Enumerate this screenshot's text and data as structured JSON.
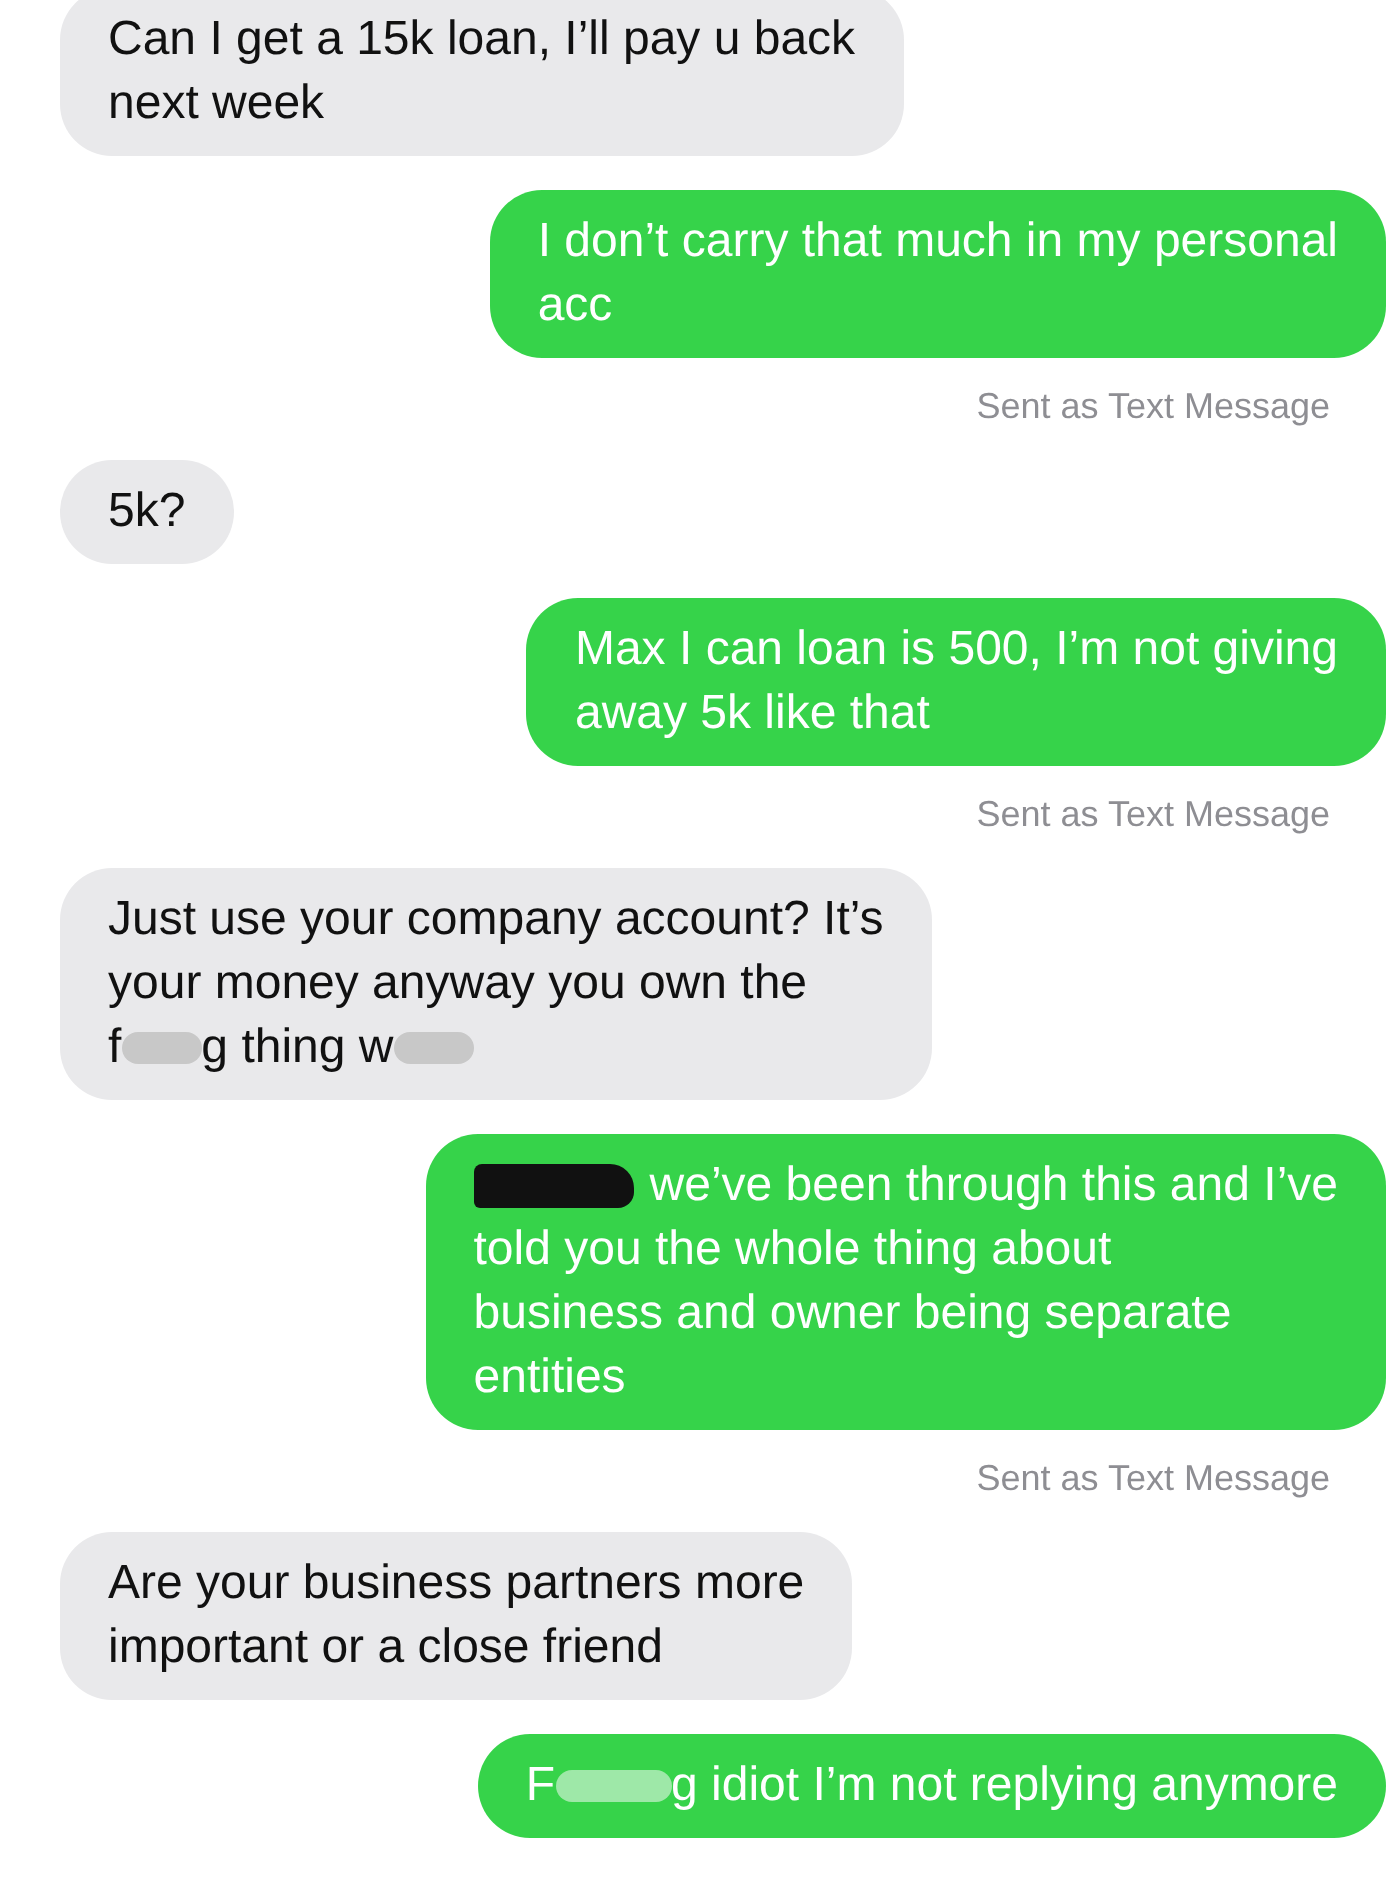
{
  "messages": [
    {
      "kind": "received",
      "lines": [
        [
          {
            "kind": "text",
            "text": "Can I get a 15k loan, I’ll pay u back"
          }
        ],
        [
          {
            "kind": "text",
            "text": "next week"
          }
        ]
      ]
    },
    {
      "kind": "sent",
      "lines": [
        [
          {
            "kind": "text",
            "text": "I don’t carry that much in my personal"
          }
        ],
        [
          {
            "kind": "text",
            "text": "acc"
          }
        ]
      ],
      "status": "Sent as Text Message"
    },
    {
      "kind": "received",
      "lines": [
        [
          {
            "kind": "text",
            "text": "5k?"
          }
        ]
      ]
    },
    {
      "kind": "sent",
      "lines": [
        [
          {
            "kind": "text",
            "text": "Max I can loan is 500, I’m not giving"
          }
        ],
        [
          {
            "kind": "text",
            "text": "away 5k like that"
          }
        ]
      ],
      "status": "Sent as Text Message"
    },
    {
      "kind": "received",
      "lines": [
        [
          {
            "kind": "text",
            "text": "Just use your company account? It’s"
          }
        ],
        [
          {
            "kind": "text",
            "text": "your money anyway you own the"
          }
        ],
        [
          {
            "kind": "text",
            "text": "f"
          },
          {
            "kind": "blur"
          },
          {
            "kind": "text",
            "text": "g thing w"
          },
          {
            "kind": "blur"
          }
        ]
      ]
    },
    {
      "kind": "sent",
      "lines": [
        [
          {
            "kind": "scribble"
          },
          {
            "kind": "text",
            "text": "we’ve been through this and I’ve"
          }
        ],
        [
          {
            "kind": "text",
            "text": "told you the whole thing about"
          }
        ],
        [
          {
            "kind": "text",
            "text": "business and owner being separate"
          }
        ],
        [
          {
            "kind": "text",
            "text": "entities"
          }
        ]
      ],
      "status": "Sent as Text Message"
    },
    {
      "kind": "received",
      "lines": [
        [
          {
            "kind": "text",
            "text": "Are your business partners more"
          }
        ],
        [
          {
            "kind": "text",
            "text": "important or a close friend"
          }
        ]
      ]
    },
    {
      "kind": "sent",
      "lines": [
        [
          {
            "kind": "text",
            "text": "F"
          },
          {
            "kind": "blur"
          },
          {
            "kind": "text",
            "text": "g idiot I’m not replying anymore"
          }
        ]
      ]
    }
  ]
}
